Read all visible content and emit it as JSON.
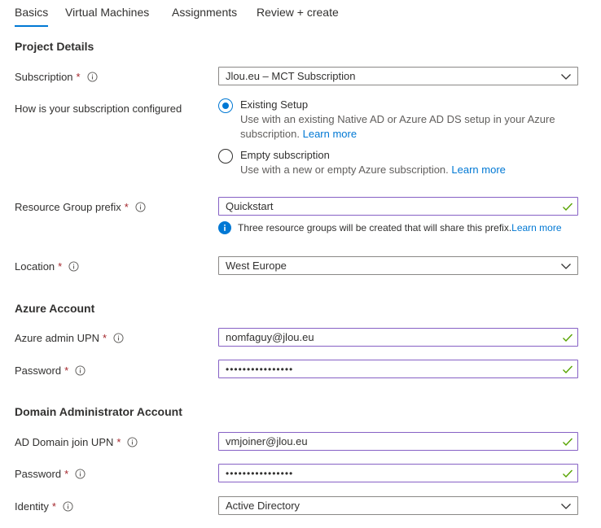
{
  "tabs": [
    {
      "label": "Basics"
    },
    {
      "label": "Virtual Machines"
    },
    {
      "label": "Assignments"
    },
    {
      "label": "Review + create"
    }
  ],
  "project": {
    "title": "Project Details",
    "subscription": {
      "label": "Subscription",
      "required": "*",
      "value": "Jlou.eu – MCT Subscription"
    },
    "config": {
      "label": "How is your subscription configured",
      "existing": {
        "label": "Existing Setup",
        "desc": "Use with an existing Native AD or Azure AD DS setup in your Azure subscription.",
        "link": "Learn more"
      },
      "empty": {
        "label": "Empty subscription",
        "desc": "Use with a new or empty Azure subscription.",
        "link": "Learn more"
      }
    },
    "rg_prefix": {
      "label": "Resource Group prefix",
      "required": "*",
      "value": "Quickstart",
      "note": "Three resource groups will be created that will share this prefix.",
      "note_link": "Learn more"
    },
    "location": {
      "label": "Location",
      "required": "*",
      "value": "West Europe"
    }
  },
  "azure_account": {
    "title": "Azure Account",
    "upn": {
      "label": "Azure admin UPN",
      "required": "*",
      "value": "nomfaguy@jlou.eu"
    },
    "password": {
      "label": "Password",
      "required": "*",
      "value": "••••••••••••••••"
    }
  },
  "domain_account": {
    "title": "Domain Administrator Account",
    "upn": {
      "label": "AD Domain join UPN",
      "required": "*",
      "value": "vmjoiner@jlou.eu"
    },
    "password": {
      "label": "Password",
      "required": "*",
      "value": "••••••••••••••••"
    },
    "identity": {
      "label": "Identity",
      "required": "*",
      "value": "Active Directory"
    }
  },
  "colors": {
    "accent": "#0078d4",
    "required": "#a4262c",
    "valid_border": "#8661c5",
    "check": "#57a300"
  }
}
